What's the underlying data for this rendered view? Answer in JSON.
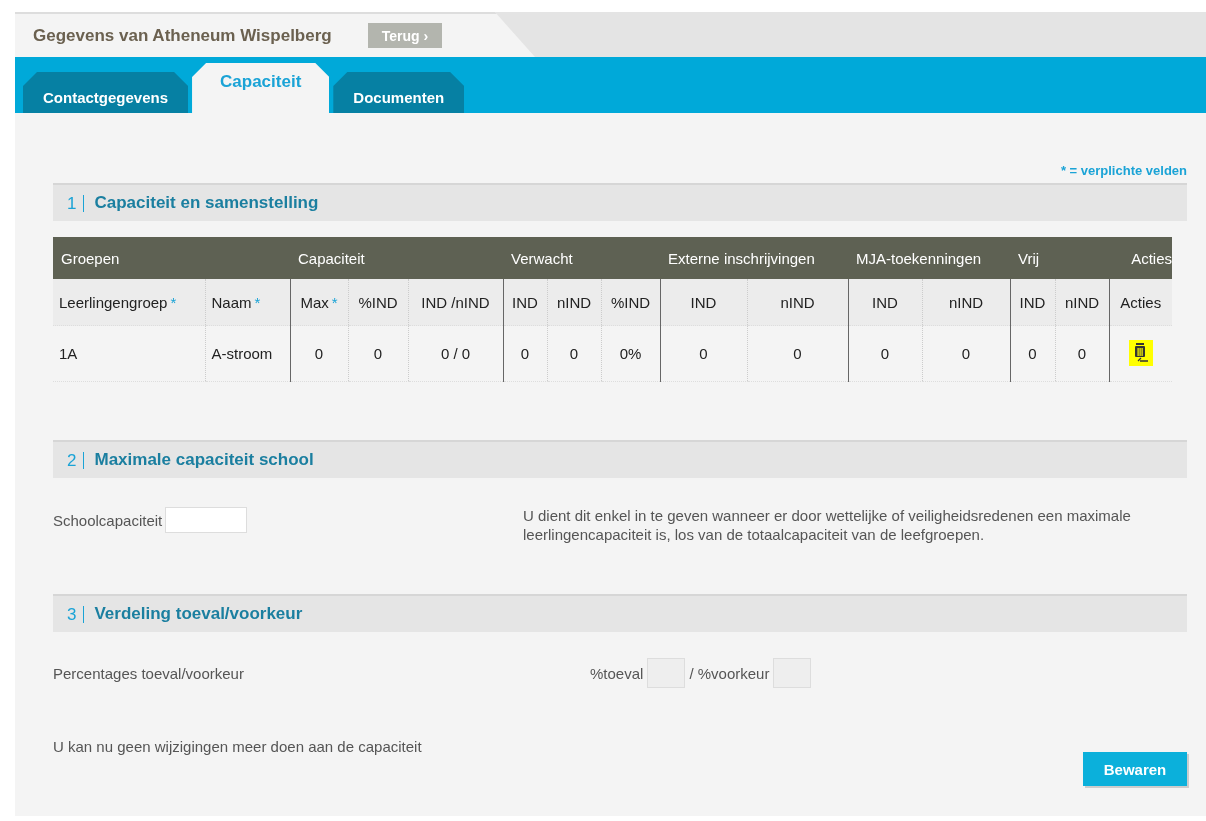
{
  "header": {
    "title": "Gegevens van Atheneum Wispelberg",
    "back_button": "Terug",
    "back_arrow": "›"
  },
  "tabs": [
    {
      "label": "Contactgegevens",
      "selected": false
    },
    {
      "label": "Capaciteit",
      "selected": true
    },
    {
      "label": "Documenten",
      "selected": false
    }
  ],
  "required_note": "* = verplichte velden",
  "sections": [
    {
      "number": "1",
      "title": "Capaciteit en samenstelling"
    },
    {
      "number": "2",
      "title": "Maximale capaciteit school"
    },
    {
      "number": "3",
      "title": "Verdeling toeval/voorkeur"
    }
  ],
  "table": {
    "groups": [
      {
        "label": "Groepen",
        "columns": [
          {
            "label": "Leerlingengroep",
            "required": true
          },
          {
            "label": "Naam",
            "required": true
          }
        ]
      },
      {
        "label": "Capaciteit",
        "columns": [
          {
            "label": "Max",
            "required": true
          },
          {
            "label": "%IND",
            "required": false
          },
          {
            "label": "IND /nIND",
            "required": false
          }
        ]
      },
      {
        "label": "Verwacht",
        "columns": [
          {
            "label": "IND",
            "required": false
          },
          {
            "label": "nIND",
            "required": false
          },
          {
            "label": "%IND",
            "required": false
          }
        ]
      },
      {
        "label": "Externe inschrijvingen",
        "columns": [
          {
            "label": "IND",
            "required": false
          },
          {
            "label": "nIND",
            "required": false
          }
        ]
      },
      {
        "label": "MJA-toekenningen",
        "columns": [
          {
            "label": "IND",
            "required": false
          },
          {
            "label": "nIND",
            "required": false
          }
        ]
      },
      {
        "label": "Vrij",
        "columns": [
          {
            "label": "IND",
            "required": false
          },
          {
            "label": "nIND",
            "required": false
          }
        ]
      },
      {
        "label": "Acties",
        "columns": [
          {
            "label": "Acties",
            "required": false
          }
        ]
      }
    ],
    "required_mark": "*",
    "rows": [
      {
        "cells": [
          "1A",
          "A-stroom",
          "0",
          "0",
          "0 / 0",
          "0",
          "0",
          "0%",
          "0",
          "0",
          "0",
          "0",
          "0",
          "0"
        ],
        "delete_highlighted": true
      }
    ]
  },
  "school_capacity": {
    "label": "Schoolcapaciteit",
    "note": "U dient dit enkel in te geven wanneer er door wettelijke of veiligheidsredenen een maximale leerlingencapaciteit is, los van de totaalcapaciteit van de leefgroepen."
  },
  "distribution": {
    "label": "Percentages toeval/voorkeur",
    "toeval_label": "%toeval",
    "separator": "/ %voorkeur"
  },
  "locked_note": "U kan nu geen wijzigingen meer doen aan de capaciteit",
  "save_button": "Bewaren"
}
